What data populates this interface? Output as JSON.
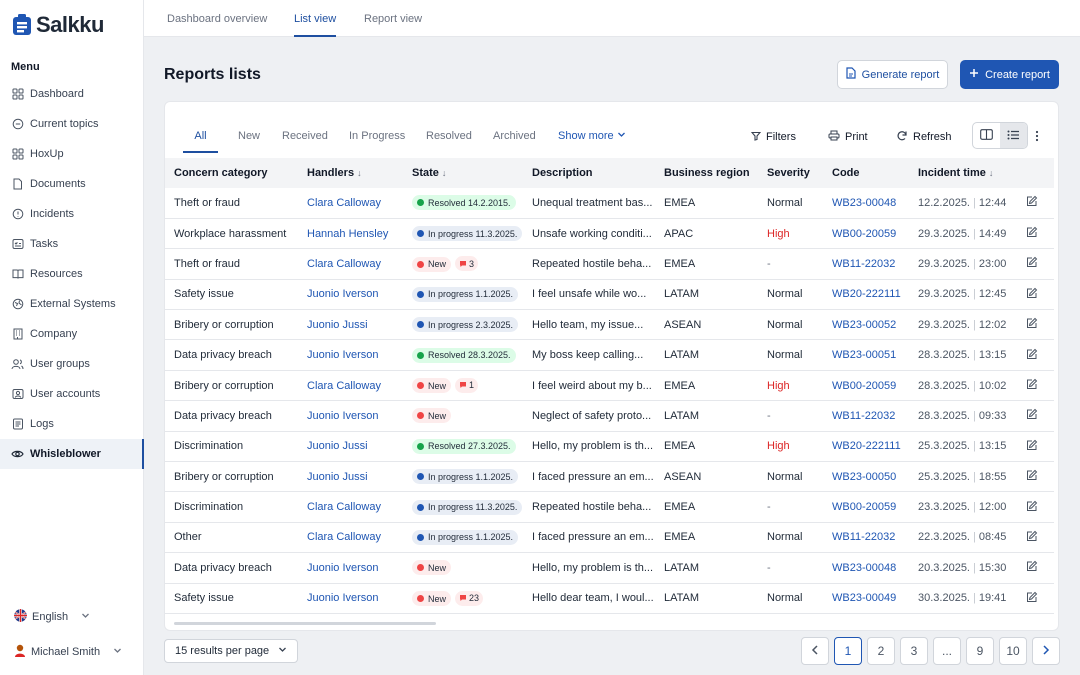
{
  "app": {
    "logo_text": "Salkku"
  },
  "colors": {
    "accent": "#1f56b3",
    "high": "#dc2626",
    "resolved": "#16a34a",
    "new": "#ef4444"
  },
  "top_tabs": [
    "Dashboard overview",
    "List view",
    "Report view"
  ],
  "active_top_tab": "List view",
  "sidebar": {
    "menu_title": "Menu",
    "items": [
      {
        "label": "Dashboard",
        "icon": "grid-icon"
      },
      {
        "label": "Current topics",
        "icon": "chat-icon"
      },
      {
        "label": "HoxUp",
        "icon": "grid-icon"
      },
      {
        "label": "Documents",
        "icon": "document-icon"
      },
      {
        "label": "Incidents",
        "icon": "alert-circle-icon"
      },
      {
        "label": "Tasks",
        "icon": "tasks-icon"
      },
      {
        "label": "Resources",
        "icon": "book-icon"
      },
      {
        "label": "External Systems",
        "icon": "globe-icon"
      },
      {
        "label": "Company",
        "icon": "building-icon"
      },
      {
        "label": "User groups",
        "icon": "users-icon"
      },
      {
        "label": "User accounts",
        "icon": "user-accounts-icon"
      },
      {
        "label": "Logs",
        "icon": "list-icon"
      },
      {
        "label": "Whisleblower",
        "icon": "eye-icon"
      }
    ],
    "active_item": "Whisleblower",
    "language": "English",
    "user": "Michael Smith"
  },
  "page": {
    "title": "Reports lists",
    "generate_label": "Generate report",
    "create_label": "Create report"
  },
  "filter_tabs": [
    "All",
    "New",
    "Received",
    "In Progress",
    "Resolved",
    "Archived"
  ],
  "active_filter_tab": "All",
  "toolbar": {
    "show_more": "Show more",
    "filters": "Filters",
    "print": "Print",
    "refresh": "Refresh"
  },
  "table": {
    "columns": [
      "Concern category",
      "Handlers",
      "State",
      "Description",
      "Business region",
      "Severity",
      "Code",
      "Incident time"
    ],
    "rows": [
      {
        "category": "Theft or fraud",
        "handler": "Clara Calloway",
        "state": {
          "type": "resolved",
          "label": "Resolved 14.2.2015."
        },
        "description": "Unequal treatment bas...",
        "region": "EMEA",
        "severity": "Normal",
        "code": "WB23-00048",
        "date": "12.2.2025.",
        "time": "12:44"
      },
      {
        "category": "Workplace harassment",
        "handler": "Hannah Hensley",
        "state": {
          "type": "progress",
          "label": "In progress 11.3.2025."
        },
        "description": "Unsafe working conditi...",
        "region": "APAC",
        "severity": "High",
        "code": "WB00-20059",
        "date": "29.3.2025.",
        "time": "14:49"
      },
      {
        "category": "Theft or fraud",
        "handler": "Clara Calloway",
        "state": {
          "type": "new",
          "label": "New",
          "comments": "3"
        },
        "description": "Repeated hostile beha...",
        "region": "EMEA",
        "severity": "-",
        "code": "WB11-22032",
        "date": "29.3.2025.",
        "time": "23:00"
      },
      {
        "category": "Safety issue",
        "handler": "Juonio Iverson",
        "state": {
          "type": "progress",
          "label": "In progress 1.1.2025."
        },
        "description": "I feel unsafe while wo...",
        "region": "LATAM",
        "severity": "Normal",
        "code": "WB20-222111",
        "date": "29.3.2025.",
        "time": "12:45"
      },
      {
        "category": "Bribery or corruption",
        "handler": "Juonio Jussi",
        "state": {
          "type": "progress",
          "label": "In progress 2.3.2025."
        },
        "description": "Hello team, my issue...",
        "region": "ASEAN",
        "severity": "Normal",
        "code": "WB23-00052",
        "date": "29.3.2025.",
        "time": "12:02"
      },
      {
        "category": "Data privacy breach",
        "handler": "Juonio Iverson",
        "state": {
          "type": "resolved",
          "label": "Resolved 28.3.2025."
        },
        "description": "My boss keep calling...",
        "region": "LATAM",
        "severity": "Normal",
        "code": "WB23-00051",
        "date": "28.3.2025.",
        "time": "13:15"
      },
      {
        "category": "Bribery or corruption",
        "handler": "Clara Calloway",
        "state": {
          "type": "new",
          "label": "New",
          "comments": "1"
        },
        "description": "I feel weird about my b...",
        "region": "EMEA",
        "severity": "High",
        "code": "WB00-20059",
        "date": "28.3.2025.",
        "time": "10:02"
      },
      {
        "category": "Data privacy breach",
        "handler": "Juonio Iverson",
        "state": {
          "type": "new",
          "label": "New"
        },
        "description": "Neglect of safety proto...",
        "region": "LATAM",
        "severity": "-",
        "code": "WB11-22032",
        "date": "28.3.2025.",
        "time": "09:33"
      },
      {
        "category": "Discrimination",
        "handler": "Juonio Jussi",
        "state": {
          "type": "resolved",
          "label": "Resolved 27.3.2025."
        },
        "description": "Hello, my problem is th...",
        "region": "EMEA",
        "severity": "High",
        "code": "WB20-222111",
        "date": "25.3.2025.",
        "time": "13:15"
      },
      {
        "category": "Bribery or corruption",
        "handler": "Juonio Jussi",
        "state": {
          "type": "progress",
          "label": "In progress 1.1.2025."
        },
        "description": "I faced pressure an em...",
        "region": "ASEAN",
        "severity": "Normal",
        "code": "WB23-00050",
        "date": "25.3.2025.",
        "time": "18:55"
      },
      {
        "category": "Discrimination",
        "handler": "Clara Calloway",
        "state": {
          "type": "progress",
          "label": "In progress 11.3.2025."
        },
        "description": "Repeated hostile beha...",
        "region": "EMEA",
        "severity": "-",
        "code": "WB00-20059",
        "date": "23.3.2025.",
        "time": "12:00"
      },
      {
        "category": "Other",
        "handler": "Clara Calloway",
        "state": {
          "type": "progress",
          "label": "In progress 1.1.2025."
        },
        "description": "I faced pressure an em...",
        "region": "EMEA",
        "severity": "Normal",
        "code": "WB11-22032",
        "date": "22.3.2025.",
        "time": "08:45"
      },
      {
        "category": "Data privacy breach",
        "handler": "Juonio Iverson",
        "state": {
          "type": "new",
          "label": "New"
        },
        "description": "Hello, my problem is th...",
        "region": "LATAM",
        "severity": "-",
        "code": "WB23-00048",
        "date": "20.3.2025.",
        "time": "15:30"
      },
      {
        "category": "Safety issue",
        "handler": "Juonio Iverson",
        "state": {
          "type": "new",
          "label": "New",
          "comments": "23"
        },
        "description": "Hello dear team, I woul...",
        "region": "LATAM",
        "severity": "Normal",
        "code": "WB23-00049",
        "date": "30.3.2025.",
        "time": "19:41"
      }
    ]
  },
  "pagination": {
    "per_page_label": "15 results per page",
    "pages": [
      "1",
      "2",
      "3",
      "...",
      "9",
      "10"
    ],
    "current": "1"
  }
}
